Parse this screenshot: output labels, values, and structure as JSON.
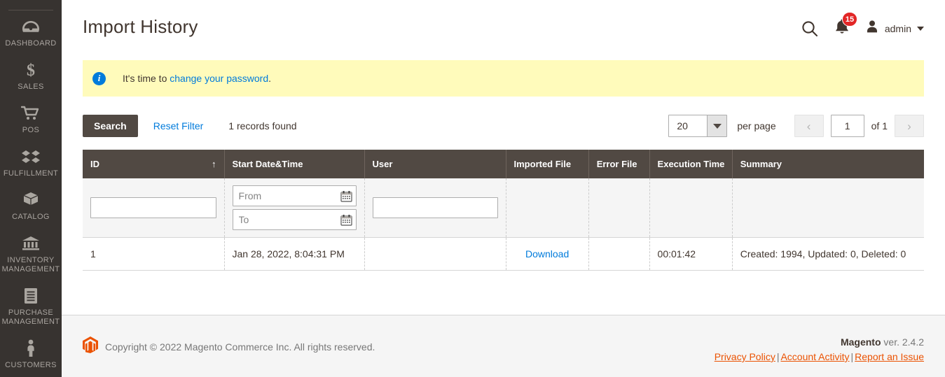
{
  "sidebar": {
    "items": [
      {
        "label": "DASHBOARD",
        "icon": "dashboard-gauge-icon"
      },
      {
        "label": "SALES",
        "icon": "dollar-sign-icon"
      },
      {
        "label": "POS",
        "icon": "shopping-cart-icon"
      },
      {
        "label": "FULFILLMENT",
        "icon": "boxes-stack-icon"
      },
      {
        "label": "CATALOG",
        "icon": "package-box-icon"
      },
      {
        "label": "INVENTORY MANAGEMENT",
        "icon": "bank-building-icon"
      },
      {
        "label": "PURCHASE MANAGEMENT",
        "icon": "document-list-icon"
      },
      {
        "label": "CUSTOMERS",
        "icon": "person-icon"
      }
    ]
  },
  "header": {
    "title": "Import History",
    "search_icon": "search-icon",
    "notifications_icon": "bell-icon",
    "notifications_count": "15",
    "avatar_icon": "user-avatar-icon",
    "admin_label": "admin",
    "caret_icon": "chevron-down-icon"
  },
  "notice": {
    "icon": "info-icon",
    "prefix": "It's time to ",
    "link": "change your password",
    "suffix": "."
  },
  "toolbar": {
    "search_label": "Search",
    "reset_filter_label": "Reset Filter",
    "records_found": "1 records found",
    "per_page_value": "20",
    "per_page_label": "per page",
    "prev_icon": "chevron-left-icon",
    "next_icon": "chevron-right-icon",
    "current_page": "1",
    "of_label": "of 1"
  },
  "grid": {
    "columns": [
      {
        "label": "ID",
        "sorted": "asc",
        "sort_icon": "↑"
      },
      {
        "label": "Start Date&Time"
      },
      {
        "label": "User"
      },
      {
        "label": "Imported File"
      },
      {
        "label": "Error File"
      },
      {
        "label": "Execution Time"
      },
      {
        "label": "Summary"
      }
    ],
    "filters": {
      "id_value": "",
      "date_from_placeholder": "From",
      "date_from_value": "",
      "date_to_placeholder": "To",
      "date_to_value": "",
      "user_value": "",
      "calendar_icon": "calendar-icon"
    },
    "rows": [
      {
        "id": "1",
        "start_datetime": "Jan 28, 2022, 8:04:31 PM",
        "user": "",
        "imported_file": "Download",
        "error_file": "",
        "execution_time": "00:01:42",
        "summary": "Created: 1994, Updated: 0, Deleted: 0"
      }
    ]
  },
  "footer": {
    "logo_icon": "magento-logo-icon",
    "copyright": "Copyright © 2022 Magento Commerce Inc. All rights reserved.",
    "brand": "Magento",
    "version": " ver. 2.4.2",
    "links": [
      {
        "label": "Privacy Policy"
      },
      {
        "label": "Account Activity"
      },
      {
        "label": "Report an Issue"
      }
    ],
    "separator": "|"
  },
  "colors": {
    "sidebar_bg": "#373330",
    "table_header_bg": "#514943",
    "link_blue": "#007bdb",
    "notice_bg": "#fffbbb",
    "badge_red": "#e22626",
    "magento_orange": "#eb5202"
  }
}
